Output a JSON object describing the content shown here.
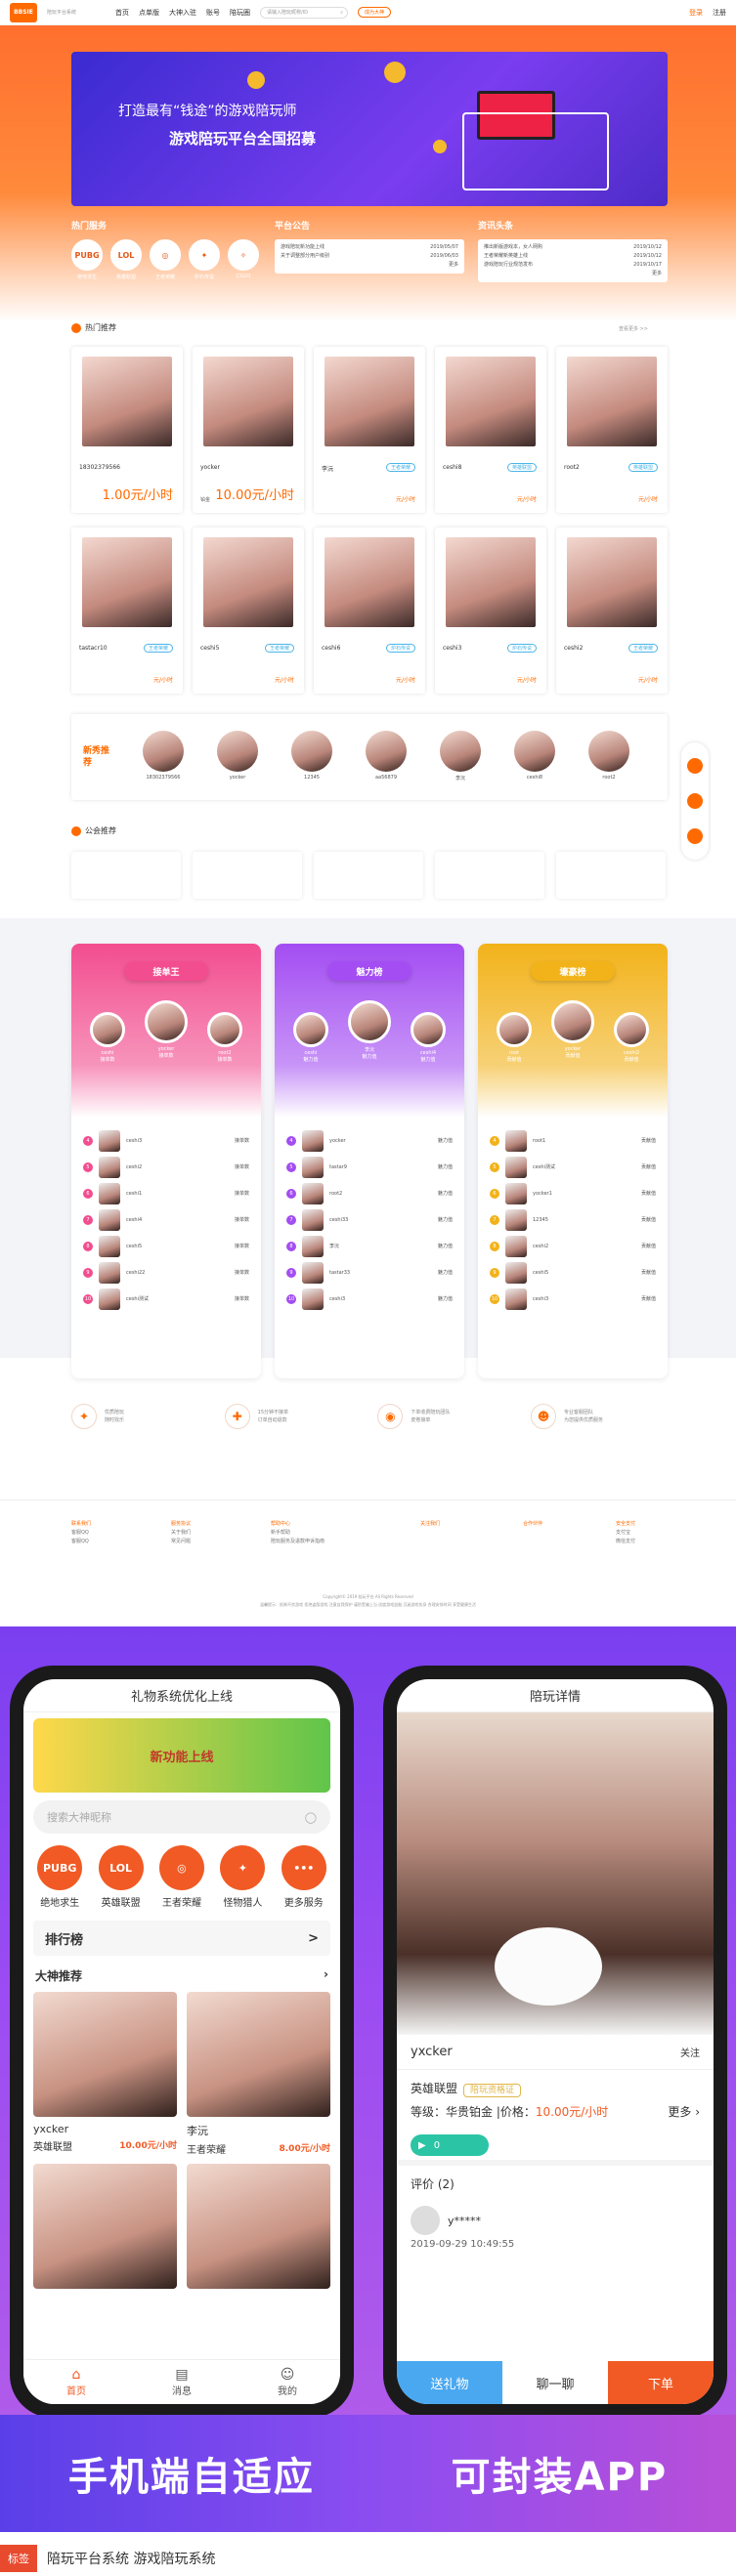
{
  "nav": {
    "logo": "BBSIE",
    "logo_sub": "陪玩平台系统",
    "items": [
      "首页",
      "点单版",
      "大神入驻",
      "账号",
      "陪玩圈"
    ],
    "search_placeholder": "请输入陪玩昵称/ID",
    "join": "成为大神",
    "login": "登录",
    "register": "注册"
  },
  "banner": {
    "line1": "打造最有“钱途”的游戏陪玩师",
    "line2": "游戏陪玩平台全国招募"
  },
  "hot_services": {
    "title": "热门服务",
    "more": "更多",
    "items": [
      {
        "icon": "PUBG",
        "label": "绝地求生"
      },
      {
        "icon": "LOL",
        "label": "英雄联盟"
      },
      {
        "icon": "◎",
        "label": "王者荣耀"
      },
      {
        "icon": "✦",
        "label": "炉石传说"
      },
      {
        "icon": "✧",
        "label": "CSGO"
      }
    ]
  },
  "announcements": {
    "title": "平台公告",
    "items": [
      {
        "text": "游戏陪玩新功能上线",
        "date": "2019/05/07"
      },
      {
        "text": "关于调整部分用户级别",
        "date": "2019/06/03"
      }
    ],
    "more": "更多"
  },
  "news": {
    "title": "资讯头条",
    "items": [
      {
        "text": "推出新版游戏本，女人网购",
        "date": "2019/10/12"
      },
      {
        "text": "王者荣耀新英雄上线",
        "date": "2019/10/12"
      },
      {
        "text": "游戏陪玩行业规范发布",
        "date": "2019/10/17"
      }
    ],
    "more": "更多"
  },
  "hot_recommend": {
    "title": "热门推荐",
    "more": "查看更多 >>",
    "row1": [
      {
        "name": "18302379566",
        "tag": "",
        "price": "1.00元/小时",
        "big": true,
        "lvl": ""
      },
      {
        "name": "yocker",
        "tag": "",
        "price": "10.00元/小时",
        "big": true,
        "lvl": "铂金"
      },
      {
        "name": "李沅",
        "tag": "王者荣耀",
        "price": "元/小时",
        "big": false,
        "lvl": ""
      },
      {
        "name": "ceshi8",
        "tag": "英雄联盟",
        "price": "元/小时",
        "big": false,
        "lvl": ""
      },
      {
        "name": "root2",
        "tag": "英雄联盟",
        "price": "元/小时",
        "big": false,
        "lvl": ""
      }
    ],
    "row2": [
      {
        "name": "tastacr10",
        "tag": "王者荣耀",
        "price": "元/小时",
        "big": false,
        "lvl": ""
      },
      {
        "name": "ceshi5",
        "tag": "王者荣耀",
        "price": "元/小时",
        "big": false,
        "lvl": ""
      },
      {
        "name": "ceshi6",
        "tag": "炉石传说",
        "price": "元/小时",
        "big": false,
        "lvl": ""
      },
      {
        "name": "ceshi3",
        "tag": "炉石传说",
        "price": "元/小时",
        "big": false,
        "lvl": ""
      },
      {
        "name": "ceshi2",
        "tag": "王者荣耀",
        "price": "元/小时",
        "big": false,
        "lvl": ""
      }
    ]
  },
  "newbie": {
    "label": "新秀推荐",
    "items": [
      "18302379566",
      "yocker",
      "12345",
      "aa56879",
      "李沅",
      "ceshi8",
      "root2"
    ]
  },
  "guild": {
    "title": "公会推荐"
  },
  "ranks": [
    {
      "title": "接单王",
      "color": "#f24d8f",
      "podium": [
        "ceshi",
        "yocker",
        "root2"
      ],
      "score_label": "接单数",
      "rows": [
        "ceshi3",
        "ceshi2",
        "ceshi1",
        "ceshi4",
        "ceshi5",
        "ceshi22",
        "ceshi测试"
      ]
    },
    {
      "title": "魅力榜",
      "color": "#a34df2",
      "podium": [
        "ceshi",
        "李沅",
        "ceshi4"
      ],
      "score_label": "魅力值",
      "rows": [
        "yocker",
        "tastar9",
        "root2",
        "ceshi33",
        "李沅",
        "tastar33",
        "ceshi3"
      ]
    },
    {
      "title": "壕豪榜",
      "color": "#f2b21a",
      "podium": [
        "root",
        "yocker",
        "ceshi2"
      ],
      "score_label": "贡献值",
      "rows": [
        "root1",
        "ceshi测试",
        "yocker1",
        "12345",
        "ceshi2",
        "ceshi5",
        "ceshi3"
      ]
    }
  ],
  "features": [
    {
      "icon": "✦",
      "l1": "优质陪玩",
      "l2": "随时找乐"
    },
    {
      "icon": "✚",
      "l1": "15分钟不接单",
      "l2": "订单自动退款"
    },
    {
      "icon": "◉",
      "l1": "下单收费陪玩团队",
      "l2": "皮卷接单"
    },
    {
      "icon": "☻",
      "l1": "专业客服团队",
      "l2": "为您提供优质服务"
    }
  ],
  "footer": {
    "cols": [
      {
        "title": "联系我们",
        "lines": [
          "客服QQ",
          "客服QQ"
        ]
      },
      {
        "title": "服务协议",
        "lines": [
          "关于我们",
          "常见问题"
        ]
      },
      {
        "title": "帮助中心",
        "lines": [
          "新手帮助",
          "陪玩服务及退款申诉指南"
        ]
      },
      {
        "title": "关注我们",
        "lines": []
      },
      {
        "title": "合作伙伴",
        "lines": []
      },
      {
        "title": "安全支付",
        "lines": [
          "支付宝",
          "微信支付"
        ]
      }
    ],
    "copyright": "Copyright© 2019 陪玩平台 All Rights Reserved",
    "links": "温馨提示：抵制不良游戏 拒绝盗版游戏 注意自我保护 谨防受骗上当 适度游戏益脑 沉迷游戏伤身 合理安排时间 享受健康生活"
  },
  "mobile_home": {
    "title": "礼物系统优化上线",
    "promo": "新功能上线",
    "search": "搜索大神昵称",
    "icons": [
      {
        "icon": "PUBG",
        "label": "绝地求生"
      },
      {
        "icon": "LOL",
        "label": "英雄联盟"
      },
      {
        "icon": "◎",
        "label": "王者荣耀"
      },
      {
        "icon": "✦",
        "label": "怪物猎人"
      },
      {
        "icon": "•••",
        "label": "更多服务"
      }
    ],
    "rank": "排行榜",
    "rank_arrow": ">",
    "section": "大神推荐",
    "cards": [
      {
        "name": "yxcker",
        "game": "英雄联盟",
        "price": "10.00元/小时"
      },
      {
        "name": "李沅",
        "game": "王者荣耀",
        "price": "8.00元/小时"
      }
    ],
    "tabs": [
      {
        "icon": "⌂",
        "label": "首页"
      },
      {
        "icon": "▤",
        "label": "消息"
      },
      {
        "icon": "☺",
        "label": "我的"
      }
    ]
  },
  "mobile_detail": {
    "title": "陪玩详情",
    "name": "yxcker",
    "follow": "关注",
    "game": "英雄联盟",
    "badge": "陪玩资格证",
    "level_line": "等级：华贵铂金 |价格：",
    "price": "10.00元/小时",
    "more": "更多",
    "voice": "0",
    "review_title": "评价 (2)",
    "reviewer": "y*****",
    "review_date": "2019-09-29 10:49:55",
    "buttons": [
      "送礼物",
      "聊一聊",
      "下单"
    ]
  },
  "slogan": {
    "left": "手机端自适应",
    "right": "可封装APP"
  },
  "caption": {
    "tag": "标签",
    "text": "陪玩平台系统  游戏陪玩系统"
  },
  "colors": {
    "accent": "#ff6a00",
    "purple": "#8b4df0"
  }
}
